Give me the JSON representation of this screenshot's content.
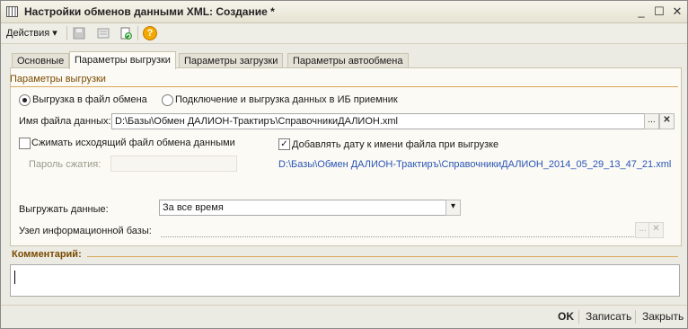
{
  "window": {
    "title": "Настройки обменов данными XML: Создание *",
    "minimize": "_",
    "maximize": "☐",
    "close": "✕"
  },
  "toolbar": {
    "actions_label": "Действия",
    "actions_arrow": "▾",
    "help_glyph": "?"
  },
  "tabs": [
    {
      "label": "Основные"
    },
    {
      "label": "Параметры выгрузки"
    },
    {
      "label": "Параметры загрузки"
    },
    {
      "label": "Параметры автообмена"
    }
  ],
  "export": {
    "section_title": "Параметры выгрузки",
    "radio_file": "Выгрузка в файл обмена",
    "radio_ib": "Подключение и выгрузка данных в ИБ приемник",
    "filename_label": "Имя файла данных:",
    "filename_value": "D:\\Базы\\Обмен ДАЛИОН-Трактиръ\\СправочникиДАЛИОН.xml",
    "compress_label": "Сжимать исходящий файл обмена данными",
    "add_date_label": "Добавлять дату к имени файла при выгрузке",
    "password_label": "Пароль сжатия:",
    "preview_path": "D:\\Базы\\Обмен ДАЛИОН-Трактиръ\\СправочникиДАЛИОН_2014_05_29_13_47_21.xml",
    "export_data_label": "Выгружать данные:",
    "export_data_value": "За все время",
    "node_label": "Узел информационной базы:",
    "node_value": "",
    "ellipsis": "...",
    "clear": "✕",
    "check_mark": "✓",
    "dropdown_arrow": "▾"
  },
  "comment": {
    "title": "Комментарий:",
    "value": ""
  },
  "footer": {
    "ok": "OK",
    "save": "Записать",
    "close": "Закрыть"
  }
}
